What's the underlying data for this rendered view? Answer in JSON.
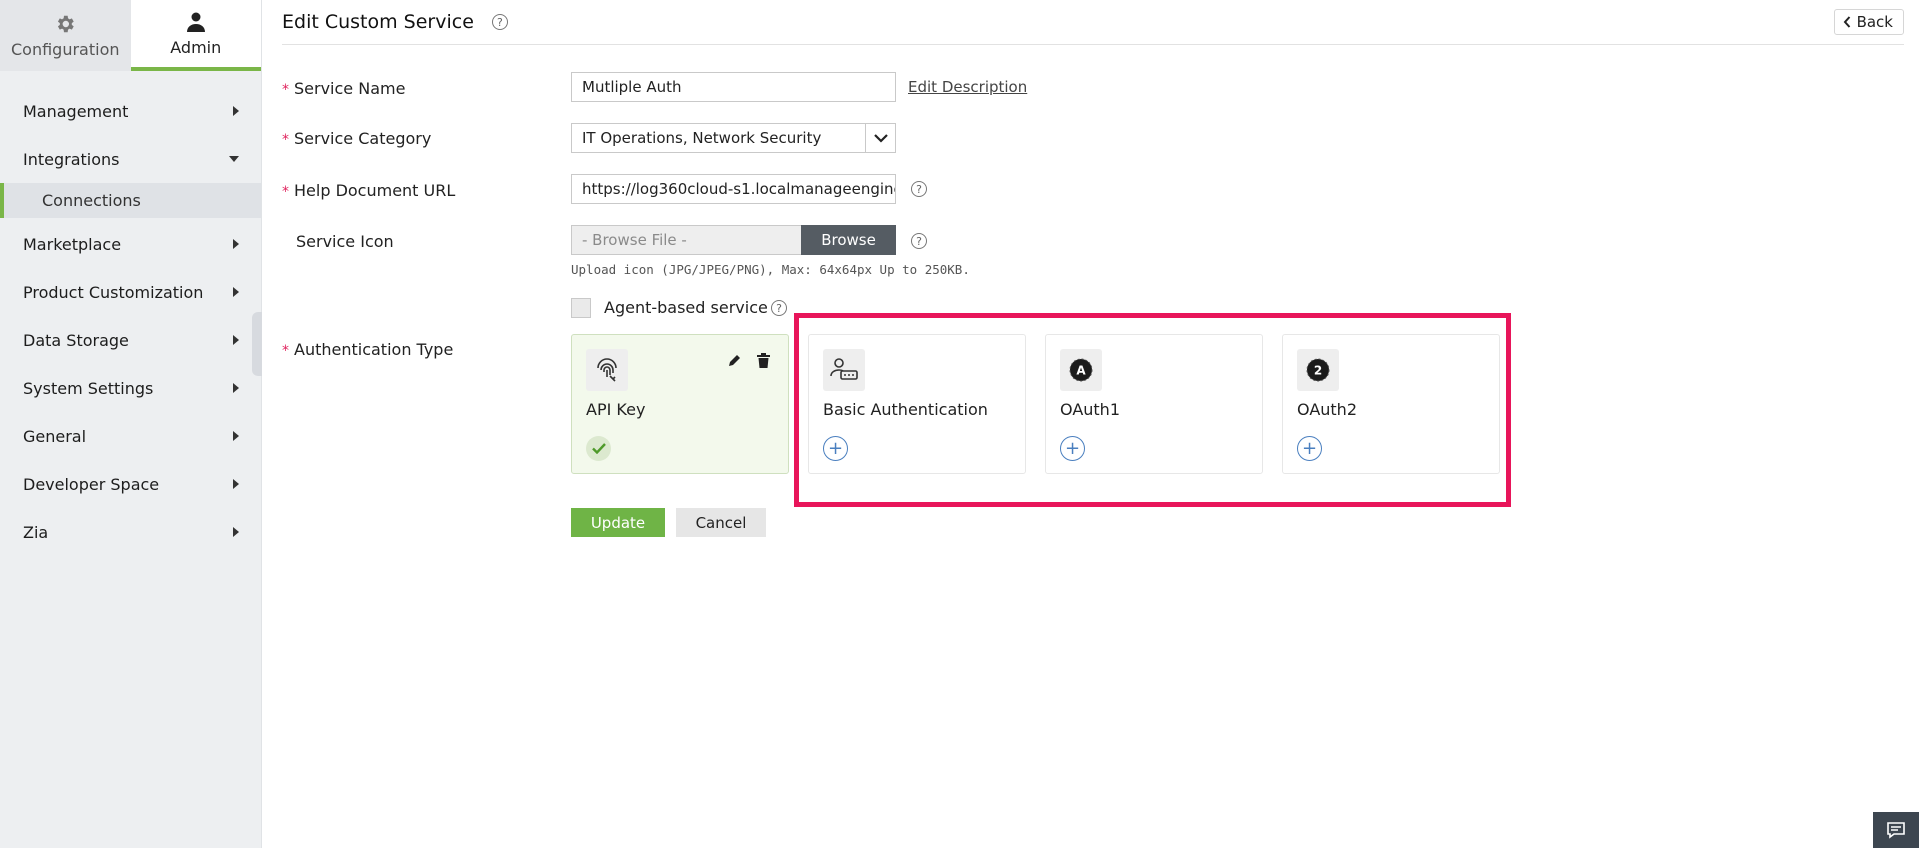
{
  "sidebar": {
    "tabs": [
      {
        "label": "Configuration",
        "icon": "gear-icon"
      },
      {
        "label": "Admin",
        "icon": "user-icon"
      }
    ],
    "items": [
      {
        "label": "Management"
      },
      {
        "label": "Integrations",
        "sub": [
          {
            "label": "Connections"
          }
        ]
      },
      {
        "label": "Marketplace"
      },
      {
        "label": "Product Customization"
      },
      {
        "label": "Data Storage"
      },
      {
        "label": "System Settings"
      },
      {
        "label": "General"
      },
      {
        "label": "Developer Space"
      },
      {
        "label": "Zia"
      }
    ]
  },
  "header": {
    "title": "Edit Custom Service",
    "back_label": "Back"
  },
  "form": {
    "service_name": {
      "label": "Service Name",
      "value": "Mutliple Auth",
      "link": "Edit Description"
    },
    "service_category": {
      "label": "Service Category",
      "value": "IT Operations, Network Security"
    },
    "help_url": {
      "label": "Help Document URL",
      "value": "https://log360cloud-s1.localmanageengine"
    },
    "service_icon": {
      "label": "Service Icon",
      "placeholder": "- Browse File -",
      "button": "Browse",
      "hint": "Upload icon (JPG/JPEG/PNG), Max: 64x64px Up to 250KB."
    },
    "agent_based": {
      "label": "Agent-based service",
      "checked": false
    },
    "auth_type": {
      "label": "Authentication Type"
    }
  },
  "auth_cards": [
    {
      "label": "API Key",
      "selected": true,
      "icon": "fingerprint-key-icon"
    },
    {
      "label": "Basic Authentication",
      "selected": false,
      "icon": "user-password-icon"
    },
    {
      "label": "OAuth1",
      "selected": false,
      "icon": "oauth1-icon",
      "badge": "A"
    },
    {
      "label": "OAuth2",
      "selected": false,
      "icon": "oauth2-icon",
      "badge": "2"
    }
  ],
  "actions": {
    "update": "Update",
    "cancel": "Cancel"
  },
  "colors": {
    "accent_green": "#7ab648",
    "highlight": "#e8155a",
    "required": "#e0245e",
    "link_blue": "#4a7fbf"
  }
}
